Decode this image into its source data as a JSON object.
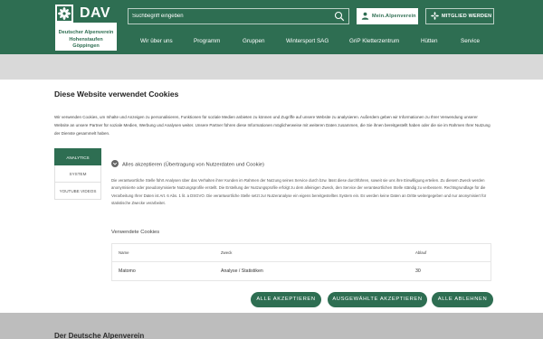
{
  "header": {
    "logo": {
      "brand": "DAV",
      "line1": "Deutscher Alpenverein",
      "line2": "Hohenstaufen Göppingen"
    },
    "search": {
      "placeholder": "Suchbegriff eingeben"
    },
    "mein_label": "Mein.Alpenverein",
    "mitglied_label": "MITGLIED WERDEN",
    "nav": [
      "Wir über uns",
      "Programm",
      "Gruppen",
      "Wintersport SAG",
      "GriP Kletterzentrum",
      "Hütten",
      "Service"
    ]
  },
  "consent": {
    "title": "Diese Website verwendet Cookies",
    "intro": "Wir verwenden Cookies, um Inhalte und Anzeigen zu personalisieren, Funktionen für soziale Medien anbieten zu können und Zugriffe auf unsere Website zu analysieren. Außerdem geben wir Informationen zu Ihrer Verwendung unserer Website an unsere Partner für soziale Medien, Werbung und Analysen weiter. Unsere Partner führen diese Informationen möglicherweise mit weiteren Daten zusammen, die Sie ihnen bereitgestellt haben oder die sie im Rahmen Ihrer Nutzung der Dienste gesammelt haben.",
    "tabs": [
      "ANALYTICS",
      "SYSTEM",
      "YOUTUBE VIDEOS"
    ],
    "accordion_label": "Alles akzeptieren (Übertragung von Nutzerdaten und Cookie)",
    "detail": "Die verantwortliche Stelle führt Analysen über das Verhalten ihrer Kunden im Rahmen der Nutzung seines Service durch bzw. lässt diese durchführen, soweit sie uns ihre Einwilligung erteilen. Zu diesem Zweck werden anonymisierte oder pseudonymisierte Nutzungsprofile erstellt. Die Erstellung der Nutzungsprofile erfolgt zu dem alleinigen Zweck, den Service der verantwortlichen Stelle ständig zu verbessern. Rechtsgrundlage für die Verarbeitung Ihrer Daten ist Art. 6 Abs. 1 lit. a DSGVO. Die verantwortliche Stelle setzt zur Nutzeranalyse ein eigens bereitgestelltes System ein. Es werden keine Daten an Dritte weitergegeben und nur anonymisiert für statistische Zwecke verarbeitet.",
    "cookies_title": "Verwendete Cookies",
    "table": {
      "headers": [
        "Name",
        "Zweck",
        "Ablauf"
      ],
      "rows": [
        [
          "Matomo",
          "Analyse / Statistiken",
          "30"
        ]
      ]
    },
    "buttons": {
      "accept_all": "ALLE AKZEPTIEREN",
      "accept_selected": "AUSGEWÄHLTE AKZEPTIEREN",
      "reject_all": "ALLE ABLEHNEN"
    }
  },
  "footer": {
    "title": "Der Deutsche Alpenverein"
  },
  "colors": {
    "brand_green": "#2e6e52"
  }
}
